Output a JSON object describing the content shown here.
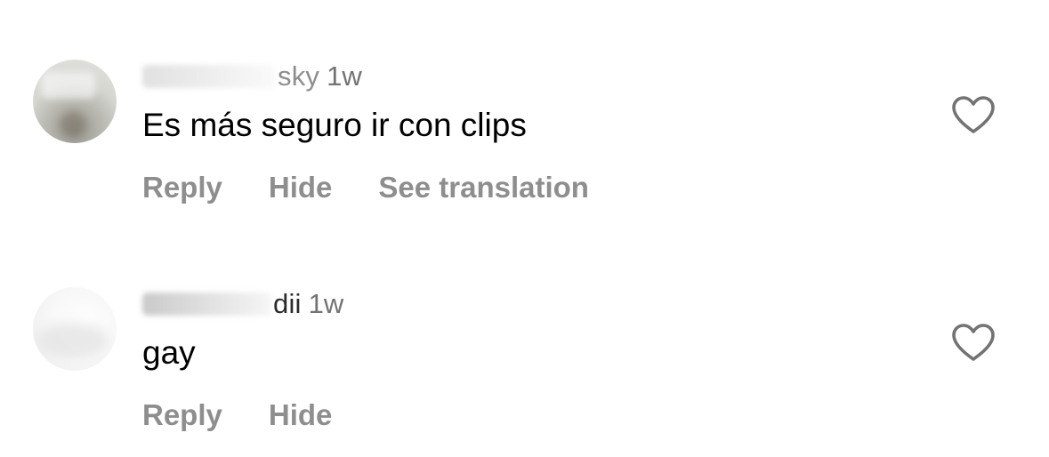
{
  "comments": [
    {
      "username_visible": "sky",
      "time": "1w",
      "text": "Es más seguro ir con clips",
      "actions": [
        "Reply",
        "Hide",
        "See translation"
      ]
    },
    {
      "username_visible": "dii",
      "time": "1w",
      "text": "gay",
      "actions": [
        "Reply",
        "Hide"
      ]
    }
  ],
  "colors": {
    "secondary_text": "#8e8e8e",
    "time_text": "#737373",
    "icon_stroke": "#737373"
  },
  "icons": {
    "like": "heart-outline-icon"
  }
}
